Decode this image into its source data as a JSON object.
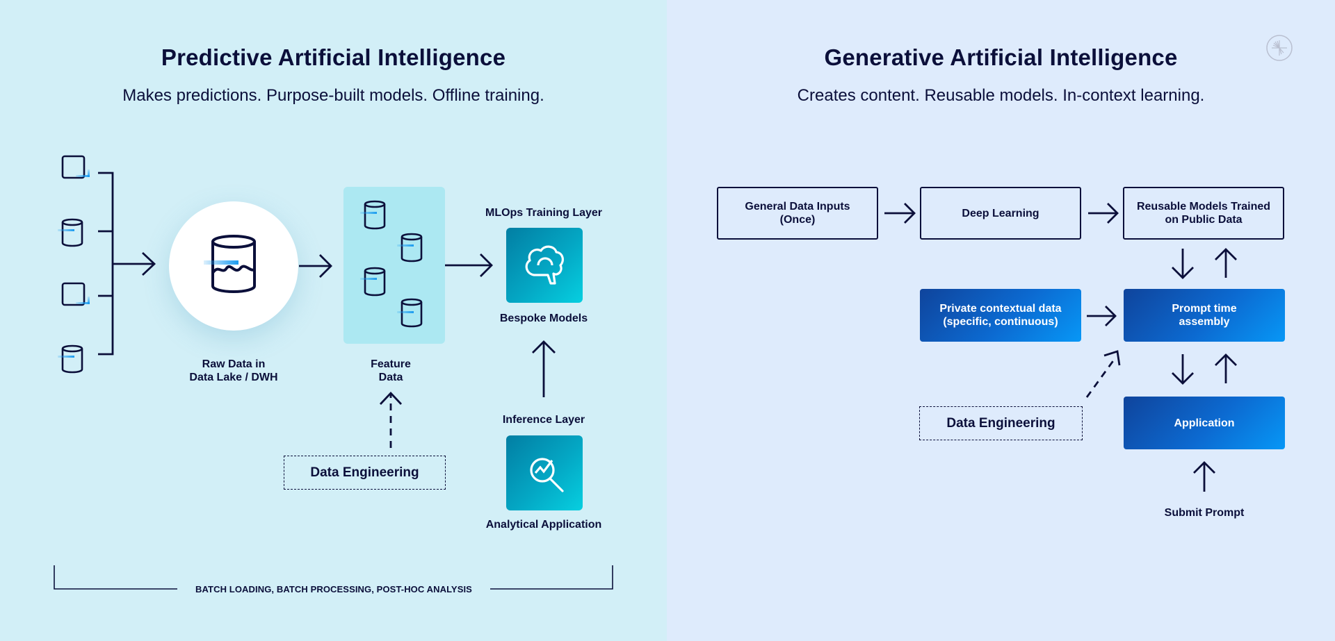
{
  "predictive": {
    "title": "Predictive Artificial Intelligence",
    "subtitle": "Makes predictions. Purpose-built models. Offline training.",
    "sources": [
      {
        "icon": "document-icon"
      },
      {
        "icon": "database-icon"
      },
      {
        "icon": "document-icon"
      },
      {
        "icon": "database-icon"
      }
    ],
    "raw_data_label_line1": "Raw Data in",
    "raw_data_label_line2": "Data Lake / DWH",
    "feature_label_line1": "Feature",
    "feature_label_line2": "Data",
    "mlops_label": "MLOps Training Layer",
    "bespoke_label": "Bespoke Models",
    "inference_label": "Inference Layer",
    "analytical_label": "Analytical Application",
    "data_engineering_label": "Data Engineering",
    "footer_label": "BATCH LOADING, BATCH PROCESSING, POST-HOC ANALYSIS"
  },
  "generative": {
    "title": "Generative Artificial Intelligence",
    "subtitle": "Creates content. Reusable models. In-context learning.",
    "general_inputs_line1": "General Data Inputs",
    "general_inputs_line2": "(Once)",
    "deep_learning": "Deep Learning",
    "reusable_models_line1": "Reusable Models Trained",
    "reusable_models_line2": "on Public Data",
    "private_data_line1": "Private contextual data",
    "private_data_line2": "(specific, continuous)",
    "prompt_assembly_line1": "Prompt time",
    "prompt_assembly_line2": "assembly",
    "data_engineering_label": "Data Engineering",
    "application": "Application",
    "submit_prompt": "Submit Prompt"
  },
  "colors": {
    "left_bg": "#d2eff7",
    "right_bg": "#deebfc",
    "ink": "#0b0f3a",
    "accent_blue": "#1a9bf0",
    "teal_tile": "#04a7c4",
    "blue_box": "#0c6ad1"
  },
  "logo": {
    "icon": "brand-logo-icon"
  }
}
